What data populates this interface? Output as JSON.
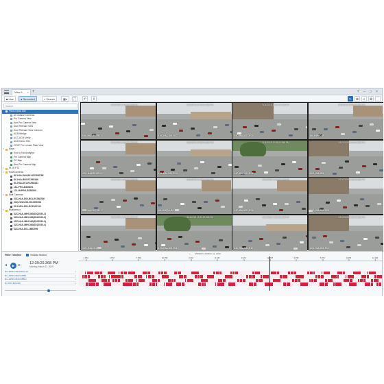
{
  "app": {
    "tab_label": "View 1",
    "tab_close": "×",
    "tab_add": "+",
    "window_controls": [
      "?",
      "–",
      "□",
      "×"
    ]
  },
  "toolbar": {
    "live_label": "Live",
    "recorded_label": "Recorded",
    "search_label": "Search",
    "layout_label": "▾",
    "icons": [
      "layout-grid-icon",
      "fullscreen-icon",
      "undo-icon",
      "export-icon"
    ],
    "right_icons": [
      "pointer-icon",
      "zoom-icon",
      "search-icon",
      "settings-icon",
      "more-icon"
    ]
  },
  "sidebar": {
    "search_placeholder": "Search",
    "items": [
      {
        "label": "Plano Demo Site",
        "level": 0,
        "selected": true,
        "icon": "site"
      },
      {
        "label": "All Outside Cameras",
        "level": 1,
        "icon": "view"
      },
      {
        "label": "Pro Camera View",
        "level": 1,
        "icon": "view"
      },
      {
        "label": "Non-Pro Camera View",
        "level": 1,
        "icon": "view"
      },
      {
        "label": "Door Release View",
        "level": 1,
        "icon": "view"
      },
      {
        "label": "Door Release View Intercom",
        "level": 1,
        "icon": "view"
      },
      {
        "label": "ACM Wedge",
        "level": 1,
        "icon": "view"
      },
      {
        "label": "ACC-ACM Verify",
        "level": 1,
        "icon": "view"
      },
      {
        "label": "ACM Demo Site",
        "level": 1,
        "icon": "view"
      },
      {
        "label": "CRHP Pro Lenses Plate View",
        "level": 1,
        "icon": "view"
      },
      {
        "label": "Maps",
        "level": 0,
        "icon": "folder"
      },
      {
        "label": "End to End Analytics",
        "level": 1,
        "icon": "map"
      },
      {
        "label": "Pro Camera Map",
        "level": 1,
        "icon": "map"
      },
      {
        "label": "CC Map",
        "level": 1,
        "icon": "map"
      },
      {
        "label": "Non-Pro Camera Map",
        "level": 1,
        "icon": "map"
      },
      {
        "label": "HL W PTZ",
        "level": 0,
        "icon": "folder"
      },
      {
        "label": "Roof Cameras",
        "level": 0,
        "icon": "folder"
      },
      {
        "label": "8C-H4A-D00-B01-RCS68786",
        "level": 1,
        "icon": "camera",
        "bold": true
      },
      {
        "label": "8C-H4A-B00-RC568186",
        "level": 1,
        "icon": "camera",
        "bold": true
      },
      {
        "label": "8C-H4A-D01-RC568181",
        "level": 1,
        "icon": "camera",
        "bold": true
      },
      {
        "label": "16L-PRO-B338801",
        "level": 1,
        "icon": "camera",
        "bold": true
      },
      {
        "label": "12L-H4PRO-B359500",
        "level": 1,
        "icon": "camera",
        "bold": true
      },
      {
        "label": "Wall Cameras",
        "level": 0,
        "icon": "folder"
      },
      {
        "label": "33C-H4A-D00-B01-RC568786",
        "level": 1,
        "icon": "camera",
        "bold": true
      },
      {
        "label": "33C-H4W-D01-RC2350004",
        "level": 1,
        "icon": "camera",
        "bold": true
      },
      {
        "label": "3C-H4SL-D01-RC2102749",
        "level": 1,
        "icon": "camera",
        "bold": true
      },
      {
        "label": "Multisensor",
        "level": 0,
        "icon": "folder"
      },
      {
        "label": "32C-H4A-4MH-360(2D22530-1)",
        "level": 1,
        "icon": "camera",
        "bold": true
      },
      {
        "label": "32C-H4A-4MH-360(2D22530-2)",
        "level": 1,
        "icon": "camera",
        "bold": true
      },
      {
        "label": "32C-H4A-4MH-360(2D22530-3)",
        "level": 1,
        "icon": "camera",
        "bold": true
      },
      {
        "label": "32C-H4A-4MH-360(2D22530-4)",
        "level": 1,
        "icon": "camera",
        "bold": true
      },
      {
        "label": "32C-H4A-D01-1B62999",
        "level": 1,
        "icon": "camera",
        "bold": true
      }
    ]
  },
  "cameras": [
    {
      "name": "5.0L-H4A-B01-RC1",
      "timestamp": "3/11/2018 12:39:20.368 PM",
      "scene": "lot"
    },
    {
      "name": "3.0C-H4A-D01-RC2",
      "timestamp": "3/11/2018 12:39:20.368 PM",
      "scene": "road"
    },
    {
      "name": "3.0C-H4A-D01-RC3",
      "timestamp": "3/11/2018 12:39:20.368 PM",
      "scene": "bldg"
    },
    {
      "name": "16L-H4PRO-B",
      "timestamp": "3/11/2018 12:39:20.368 PM",
      "scene": "lot"
    },
    {
      "name": "3.0C-H4A-B01-RC4",
      "timestamp": "3/11/2018 12:39:20.368 PM",
      "scene": "lot"
    },
    {
      "name": "5.0L-H4A-D01-RC5",
      "timestamp": "3/11/2018 12:39:20.368 PM",
      "scene": "road"
    },
    {
      "name": "3.0C-H4A-D01-RC6",
      "timestamp": "3/11/2018 12:39:20.368 PM",
      "scene": "tree"
    },
    {
      "name": "8.0C-H4A-D01",
      "timestamp": "3/11/2018 12:39:20.368 PM",
      "scene": "bldg"
    },
    {
      "name": "5.0L-H4A-D01-RC7",
      "timestamp": "3/11/2018 12:39:20.368 PM",
      "scene": "lot"
    },
    {
      "name": "16L-H4PRO-B2",
      "timestamp": "3/11/2018 12:39:20.368 PM",
      "scene": "lot"
    },
    {
      "name": "3.0C-H4A-D01-RC8",
      "timestamp": "3/11/2018 12:39:20.368 PM",
      "scene": "lot"
    },
    {
      "name": "3.0C-H4A-D01-RC9",
      "timestamp": "3/11/2018 12:39:20.368 PM",
      "scene": "bldg"
    },
    {
      "name": "3.0C-H4A-D01-R10",
      "timestamp": "3/11/2018 12:39:20.368 PM",
      "scene": "lot"
    },
    {
      "name": "3.0C-H4A-D01-R11",
      "timestamp": "3/11/2018 12:39:20.368 PM",
      "scene": "tree"
    },
    {
      "name": "3.0C-H4A-D01-R12",
      "timestamp": "3/11/2018 12:39:20.368 PM",
      "scene": "road"
    },
    {
      "name": "3.0C-H4A-D01-R13",
      "timestamp": "3/11/2018 12:39:20.368 PM",
      "scene": "bldg"
    }
  ],
  "timeline": {
    "title": "Filter Timeline",
    "option_label": "Browse Motion",
    "current_time": "12:39:20.368 PM",
    "current_date": "Monday, March 11, 2019",
    "ruler_date": "MONDAY, MARCH 11, 2019",
    "ticks": [
      "1 PM",
      "4 PM",
      "7 PM",
      "10 PM",
      "3 AM",
      "6 AM",
      "9 AM",
      "12 PM",
      "3 PM",
      "6 PM",
      "9 PM",
      "12 AM"
    ],
    "tracks": [
      {
        "label": "8L-H4PRO-B1(4CD2)-AA",
        "motion": [
          0.02,
          0.05,
          0.09,
          0.13,
          0.16,
          0.21,
          0.26,
          0.31,
          0.37,
          0.44,
          0.5,
          0.57,
          0.63,
          0.69,
          0.75,
          0.8,
          0.85,
          0.9,
          0.95
        ]
      },
      {
        "label": "8L-H4PRO-B(4CA2BB)",
        "motion": [
          0.01,
          0.06,
          0.1,
          0.12,
          0.18,
          0.22,
          0.27,
          0.33,
          0.38,
          0.42,
          0.48,
          0.55,
          0.6,
          0.66,
          0.71,
          0.78,
          0.83,
          0.88,
          0.93,
          0.97
        ]
      },
      {
        "label": "8L-H4PRO-B(4CCBBA)",
        "motion": [
          0.03,
          0.07,
          0.11,
          0.15,
          0.19,
          0.24,
          0.29,
          0.35,
          0.4,
          0.46,
          0.52,
          0.58,
          0.64,
          0.7,
          0.76,
          0.81,
          0.87,
          0.92,
          0.96
        ]
      },
      {
        "label": "8L-PRO-B(4C28)",
        "motion": [
          0.02,
          0.04,
          0.08,
          0.14,
          0.17,
          0.23,
          0.28,
          0.32,
          0.39,
          0.45,
          0.49,
          0.56,
          0.61,
          0.67,
          0.73,
          0.79,
          0.84,
          0.89,
          0.94,
          0.98
        ]
      }
    ],
    "playhead_position": 0.63,
    "playback_speed": 0.62
  },
  "colors": {
    "accent": "#2b6fb6",
    "motion": "#d6213c",
    "selected": "#2f72bd"
  }
}
